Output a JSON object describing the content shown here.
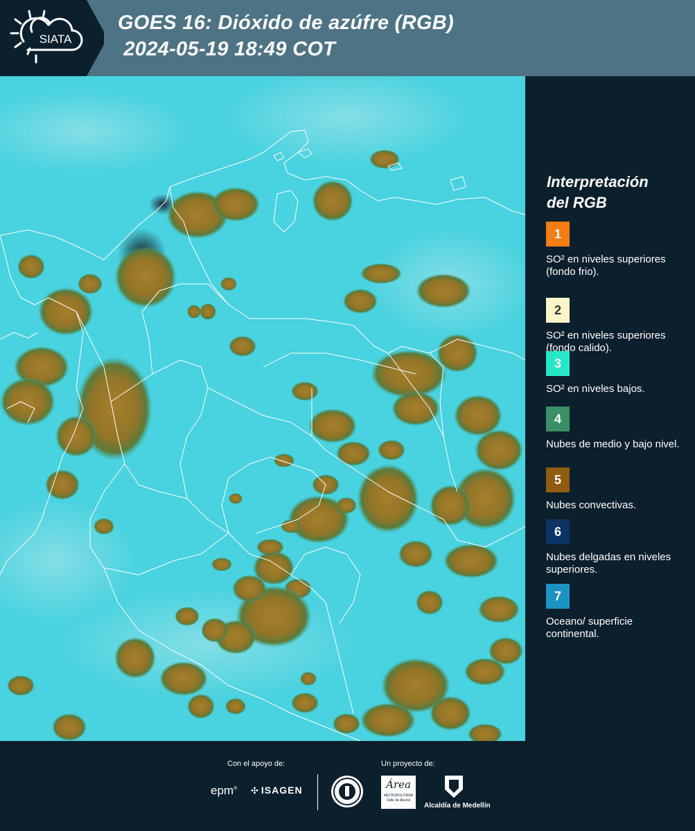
{
  "header": {
    "logo_text": "SIATA",
    "title_line1": "GOES 16: Dióxido de azúfre (RGB)",
    "title_line2": " 2024-05-19 18:49 COT"
  },
  "legend": {
    "title_line1": "Interpretación",
    "title_line2": "del RGB",
    "items": [
      {
        "num": "1",
        "color": "#f57d14",
        "label": "SO² en niveles superiores (fondo frio)."
      },
      {
        "num": "2",
        "color": "#fbf6c8",
        "label": "SO² en niveles superiores (fondo calido)."
      },
      {
        "num": "3",
        "color": "#25e8c8",
        "label": "SO² en niveles bajos."
      },
      {
        "num": "4",
        "color": "#3b8f66",
        "label": "Nubes de medio y bajo nivel."
      },
      {
        "num": "5",
        "color": "#8f5c12",
        "label": "Nubes convectivas."
      },
      {
        "num": "6",
        "color": "#0d3466",
        "label": "Nubes delgadas en niveles superiores."
      },
      {
        "num": "7",
        "color": "#1a93c2",
        "label": "Oceano/ superficie continental."
      }
    ]
  },
  "footer": {
    "support_caption": "Con el apoyo de:",
    "project_caption": "Un proyecto de:",
    "sponsor1": "epm",
    "sponsor2": "ISAGEN",
    "partner_area": "Área",
    "partner_area_sub": "METROPOLITANA",
    "partner_area_sub2": "Valle de Aburrá",
    "partner_alcaldia": "Alcaldía de Medellín"
  },
  "map": {
    "colors": {
      "background": "#49d2df",
      "cloud_brown": "#9a7a2a",
      "cloud_dark": "#6b6a2a",
      "border": "#ffffff"
    }
  }
}
